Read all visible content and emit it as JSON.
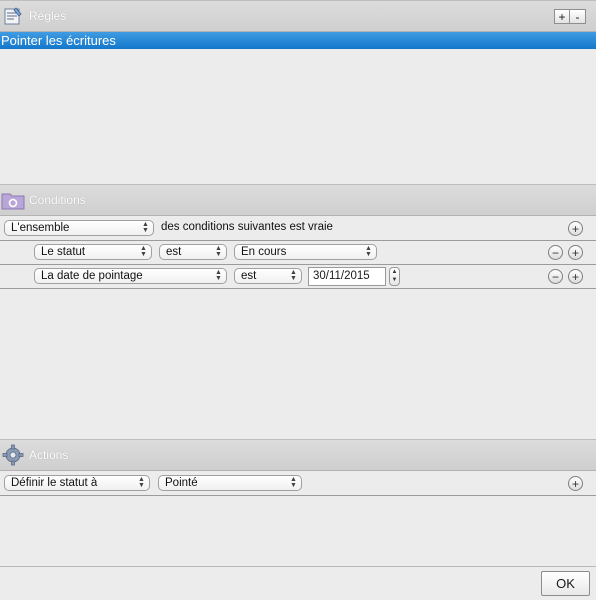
{
  "rules": {
    "title": "Règles",
    "add_label": "+",
    "remove_label": "-",
    "icon": "rules-icon",
    "items": [
      "Pointer les écritures"
    ]
  },
  "conditions": {
    "title": "Conditions",
    "icon": "folder-gear-icon",
    "header_row": {
      "match_select": "L'ensemble",
      "suffix_text": "des conditions suivantes est vraie"
    },
    "rows": [
      {
        "field": "Le statut",
        "operator": "est",
        "value": "En cours"
      },
      {
        "field": "La date de pointage",
        "operator": "est",
        "value": "30/11/2015"
      }
    ]
  },
  "actions": {
    "title": "Actions",
    "icon": "gear-icon",
    "rows": [
      {
        "action": "Définir le statut à",
        "value": "Pointé"
      }
    ]
  },
  "footer": {
    "ok_label": "OK"
  },
  "symbols": {
    "plus": "+",
    "minus": "−",
    "up_down": "▲▼"
  }
}
